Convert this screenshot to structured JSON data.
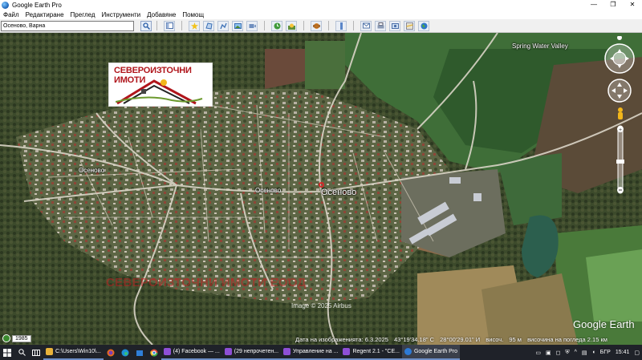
{
  "window": {
    "title": "Google Earth Pro",
    "minimize": "—",
    "restore": "❐",
    "close": "✕"
  },
  "menu": {
    "items": [
      "Файл",
      "Редактиране",
      "Преглед",
      "Инструменти",
      "Добавяне",
      "Помощ"
    ]
  },
  "search": {
    "value": "Осеново, Варна"
  },
  "map": {
    "logo_text": "СЕВЕРОИЗТОЧНИ ИМОТИ",
    "village_label": "Осеново",
    "small_label_left": "Осеново",
    "small_label_mid": "Осеново",
    "spring_label": "Spring Water Valley",
    "watermark": "СЕВЕРОИЗТОЧНИ ИМОТИ ЕООД",
    "copyright": "Image © 2025 Airbus",
    "brand": "Google Earth",
    "year": "1985"
  },
  "status": {
    "imagery_date": "Дата на изображенията: 6.3.2025",
    "lat": "43°19'34.18\" С",
    "lon": "28°00'29.01\" И",
    "elev_label": "височ.",
    "elev_value": "95 м",
    "eye_alt": "височина на погледа  2.15 км"
  },
  "taskbar": {
    "items": [
      {
        "label": "C:\\Users\\Win10\\...",
        "color": "#e8b23a"
      },
      {
        "label": "(4) Facebook — ...",
        "color": "#8e4fd6"
      },
      {
        "label": "(29 непрочетен...",
        "color": "#8e4fd6"
      },
      {
        "label": "Управление на ...",
        "color": "#8e4fd6"
      },
      {
        "label": "Regent 2.1 - \"CE...",
        "color": "#8e4fd6"
      },
      {
        "label": "Google Earth Pro",
        "color": "#2d7ad6"
      }
    ],
    "lang": "БГР",
    "time": "15:41"
  }
}
